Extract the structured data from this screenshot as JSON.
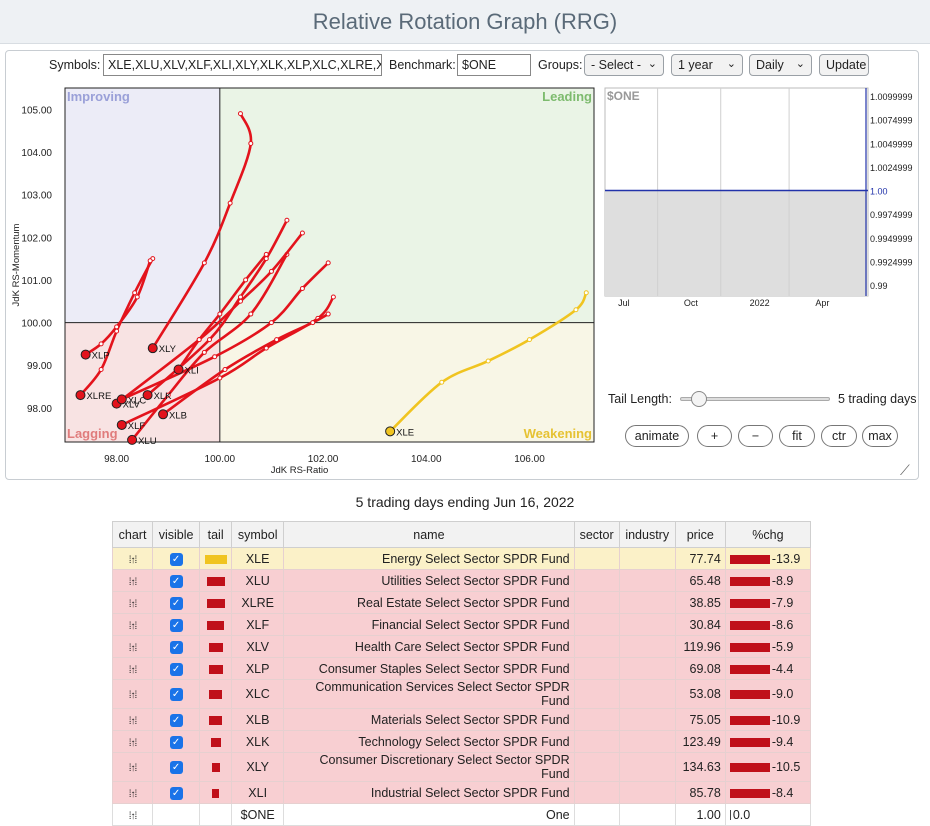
{
  "app_title": "Relative Rotation Graph (RRG)",
  "controls": {
    "symbols_label": "Symbols:",
    "symbols_value": "XLE,XLU,XLV,XLF,XLI,XLY,XLK,XLP,XLC,XLRE,XLB",
    "benchmark_label": "Benchmark:",
    "benchmark_value": "$ONE",
    "groups_label": "Groups:",
    "groups_selected": "- Select -",
    "period_selected": "1 year",
    "frequency_selected": "Daily",
    "update_label": "Update"
  },
  "rrg": {
    "quadrants": {
      "improving": "Improving",
      "leading": "Leading",
      "lagging": "Lagging",
      "weakening": "Weakening"
    },
    "quadrant_colors": {
      "improving": "#ececf7",
      "leading": "#eaf4e6",
      "lagging": "#f8e3e3",
      "weakening": "#f8f6e6"
    },
    "y_axis_label": "JdK RS-Momentum",
    "x_axis_label": "JdK RS-Ratio",
    "x_ticks": [
      "98.00",
      "100.00",
      "102.00",
      "104.00",
      "106.00"
    ],
    "y_ticks": [
      "105.00",
      "104.00",
      "103.00",
      "102.00",
      "101.00",
      "100.00",
      "99.00",
      "98.00"
    ],
    "x_range": [
      97.0,
      107.25
    ],
    "y_range": [
      97.2,
      105.5
    ],
    "series": [
      {
        "symbol": "XLE",
        "color": "#f0c420",
        "tail": [
          [
            107.1,
            100.7
          ],
          [
            106.9,
            100.3
          ],
          [
            106.0,
            99.6
          ],
          [
            105.2,
            99.1
          ],
          [
            104.3,
            98.6
          ],
          [
            103.3,
            97.45
          ]
        ]
      },
      {
        "symbol": "XLU",
        "color": "#e3131c",
        "tail": [
          [
            101.3,
            101.6
          ],
          [
            100.6,
            100.2
          ],
          [
            99.7,
            99.3
          ],
          [
            99.0,
            98.3
          ],
          [
            98.3,
            97.25
          ]
        ]
      },
      {
        "symbol": "XLRE",
        "color": "#e3131c",
        "tail": [
          [
            98.7,
            101.5
          ],
          [
            98.35,
            100.7
          ],
          [
            98.0,
            99.8
          ],
          [
            97.7,
            98.9
          ],
          [
            97.3,
            98.3
          ]
        ]
      },
      {
        "symbol": "XLF",
        "color": "#e3131c",
        "tail": [
          [
            102.2,
            100.6
          ],
          [
            101.9,
            100.1
          ],
          [
            100.9,
            99.4
          ],
          [
            100.0,
            98.7
          ],
          [
            98.1,
            97.6
          ]
        ]
      },
      {
        "symbol": "XLV",
        "color": "#e3131c",
        "tail": [
          [
            101.6,
            102.1
          ],
          [
            101.0,
            101.2
          ],
          [
            100.4,
            100.5
          ],
          [
            99.6,
            99.6
          ],
          [
            98.0,
            98.1
          ]
        ]
      },
      {
        "symbol": "XLP",
        "color": "#e3131c",
        "tail": [
          [
            98.65,
            101.45
          ],
          [
            98.4,
            100.6
          ],
          [
            98.0,
            99.9
          ],
          [
            97.7,
            99.5
          ],
          [
            97.4,
            99.25
          ]
        ]
      },
      {
        "symbol": "XLC",
        "color": "#e3131c",
        "tail": [
          [
            102.1,
            101.4
          ],
          [
            101.6,
            100.8
          ],
          [
            101.0,
            100.0
          ],
          [
            99.9,
            99.2
          ],
          [
            98.1,
            98.2
          ]
        ]
      },
      {
        "symbol": "XLB",
        "color": "#e3131c",
        "tail": [
          [
            102.1,
            100.2
          ],
          [
            101.8,
            100.0
          ],
          [
            101.1,
            99.6
          ],
          [
            100.1,
            98.9
          ],
          [
            98.9,
            97.85
          ]
        ]
      },
      {
        "symbol": "XLK",
        "color": "#e3131c",
        "tail": [
          [
            101.3,
            102.4
          ],
          [
            100.9,
            101.5
          ],
          [
            100.4,
            100.6
          ],
          [
            99.8,
            99.6
          ],
          [
            98.6,
            98.3
          ]
        ]
      },
      {
        "symbol": "XLY",
        "color": "#e3131c",
        "tail": [
          [
            100.4,
            104.9
          ],
          [
            100.6,
            104.2
          ],
          [
            100.2,
            102.8
          ],
          [
            99.7,
            101.4
          ],
          [
            98.7,
            99.4
          ]
        ]
      },
      {
        "symbol": "XLI",
        "color": "#e3131c",
        "tail": [
          [
            100.9,
            101.6
          ],
          [
            100.5,
            101.0
          ],
          [
            100.0,
            100.2
          ],
          [
            99.6,
            99.6
          ],
          [
            99.2,
            98.9
          ]
        ]
      }
    ]
  },
  "benchmark_chart": {
    "label": "$ONE",
    "value": 1.0,
    "y_ticks": [
      "1.0099999",
      "1.0074999",
      "1.0049999",
      "1.0024999",
      "1.00",
      "0.9974999",
      "0.9949999",
      "0.9924999",
      "0.99"
    ],
    "x_ticks": [
      "Jul",
      "Oct",
      "2022",
      "Apr"
    ]
  },
  "tail": {
    "label": "Tail Length:",
    "value_label": "5 trading days",
    "slider_fraction": 0.12
  },
  "actions": {
    "animate": "animate",
    "plus": "+",
    "minus": "−",
    "fit": "fit",
    "ctr": "ctr",
    "max": "max"
  },
  "table": {
    "caption": "5 trading days ending Jun 16, 2022",
    "headers": {
      "chart": "chart",
      "visible": "visible",
      "tail": "tail",
      "symbol": "symbol",
      "name": "name",
      "sector": "sector",
      "industry": "industry",
      "price": "price",
      "pctchg": "%chg"
    },
    "rows": [
      {
        "symbol": "XLE",
        "name": "Energy Select Sector SPDR Fund",
        "price": "77.74",
        "pctchg": "-13.9",
        "tail_color": "#f0c420",
        "tail_width": 22,
        "style": "yellow"
      },
      {
        "symbol": "XLU",
        "name": "Utilities Select Sector SPDR Fund",
        "price": "65.48",
        "pctchg": "-8.9",
        "tail_color": "#c0101a",
        "tail_width": 18,
        "style": "red"
      },
      {
        "symbol": "XLRE",
        "name": "Real Estate Select Sector SPDR Fund",
        "price": "38.85",
        "pctchg": "-7.9",
        "tail_color": "#c0101a",
        "tail_width": 18,
        "style": "red"
      },
      {
        "symbol": "XLF",
        "name": "Financial Select Sector SPDR Fund",
        "price": "30.84",
        "pctchg": "-8.6",
        "tail_color": "#c0101a",
        "tail_width": 17,
        "style": "red"
      },
      {
        "symbol": "XLV",
        "name": "Health Care Select Sector SPDR Fund",
        "price": "119.96",
        "pctchg": "-5.9",
        "tail_color": "#c0101a",
        "tail_width": 14,
        "style": "red"
      },
      {
        "symbol": "XLP",
        "name": "Consumer Staples Select Sector SPDR Fund",
        "price": "69.08",
        "pctchg": "-4.4",
        "tail_color": "#c0101a",
        "tail_width": 14,
        "style": "red"
      },
      {
        "symbol": "XLC",
        "name": "Communication Services Select Sector SPDR Fund",
        "price": "53.08",
        "pctchg": "-9.0",
        "tail_color": "#c0101a",
        "tail_width": 13,
        "style": "red"
      },
      {
        "symbol": "XLB",
        "name": "Materials Select Sector SPDR Fund",
        "price": "75.05",
        "pctchg": "-10.9",
        "tail_color": "#c0101a",
        "tail_width": 13,
        "style": "red"
      },
      {
        "symbol": "XLK",
        "name": "Technology Select Sector SPDR Fund",
        "price": "123.49",
        "pctchg": "-9.4",
        "tail_color": "#c0101a",
        "tail_width": 10,
        "style": "red"
      },
      {
        "symbol": "XLY",
        "name": "Consumer Discretionary Select Sector SPDR Fund",
        "price": "134.63",
        "pctchg": "-10.5",
        "tail_color": "#c0101a",
        "tail_width": 8,
        "style": "red"
      },
      {
        "symbol": "XLI",
        "name": "Industrial Select Sector SPDR Fund",
        "price": "85.78",
        "pctchg": "-8.4",
        "tail_color": "#c0101a",
        "tail_width": 7,
        "style": "red"
      }
    ],
    "benchmark_row": {
      "symbol": "$ONE",
      "name": "One",
      "price": "1.00",
      "pctchg": "0.0"
    }
  }
}
